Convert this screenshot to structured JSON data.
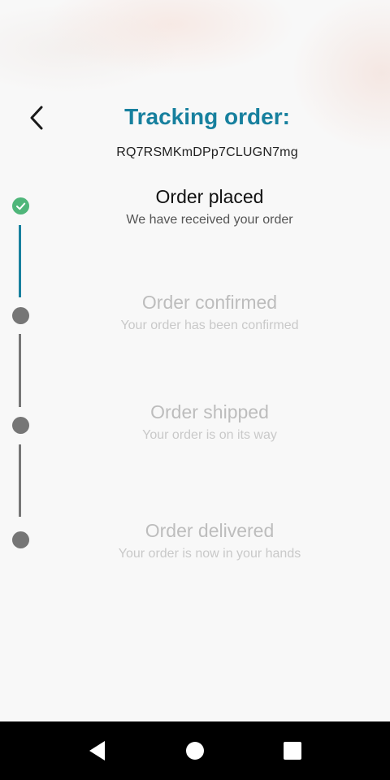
{
  "header": {
    "title": "Tracking order:",
    "order_id": "RQ7RSMKmDPp7CLUGN7mg"
  },
  "steps": [
    {
      "title": "Order placed",
      "desc": "We have received your order",
      "status": "done"
    },
    {
      "title": "Order confirmed",
      "desc": "Your order has been confirmed",
      "status": "pending"
    },
    {
      "title": "Order shipped",
      "desc": "Your order is on its way",
      "status": "pending"
    },
    {
      "title": "Order delivered",
      "desc": "Your order is now in your hands",
      "status": "pending"
    }
  ],
  "icons": {
    "back": "chevron-left-icon",
    "done": "check-icon",
    "nav_back": "triangle-back-icon",
    "nav_home": "circle-home-icon",
    "nav_recents": "square-recents-icon"
  },
  "colors": {
    "accent": "#17809e",
    "done": "#4fb67a",
    "pending": "#767676"
  }
}
